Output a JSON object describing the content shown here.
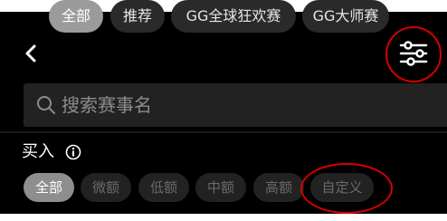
{
  "tabs": [
    {
      "label": "全部",
      "selected": true
    },
    {
      "label": "推荐",
      "selected": false
    },
    {
      "label": "GG全球狂欢赛",
      "selected": false
    },
    {
      "label": "GG大师赛",
      "selected": false
    }
  ],
  "search": {
    "placeholder": "搜索赛事名"
  },
  "buy_in": {
    "label": "买入",
    "options": [
      {
        "label": "全部",
        "selected": true
      },
      {
        "label": "微额",
        "selected": false
      },
      {
        "label": "低额",
        "selected": false
      },
      {
        "label": "中额",
        "selected": false
      },
      {
        "label": "高额",
        "selected": false
      },
      {
        "label": "自定义",
        "selected": false
      }
    ]
  },
  "icons": {
    "back": "chevron-left-icon",
    "filter": "sliders-icon",
    "search": "search-icon",
    "info": "info-icon"
  },
  "colors": {
    "background": "#000000",
    "chip": "#2a2a2a",
    "chip_selected": "#9b9b9b",
    "annotation": "#d80000"
  }
}
